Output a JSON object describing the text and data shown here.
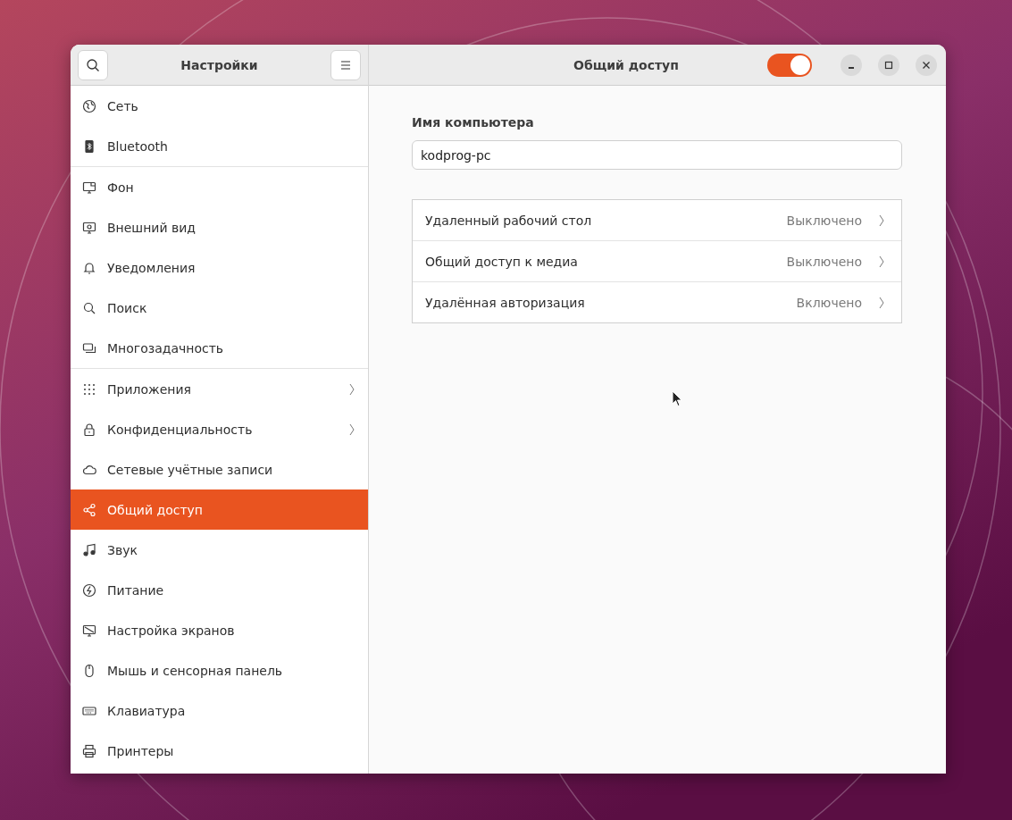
{
  "sidebar": {
    "title": "Настройки",
    "sections": [
      {
        "items": [
          {
            "label": "Сеть",
            "selected": false,
            "arrow": false
          },
          {
            "label": "Bluetooth",
            "selected": false,
            "arrow": false
          }
        ]
      },
      {
        "items": [
          {
            "label": "Фон",
            "selected": false,
            "arrow": false
          },
          {
            "label": "Внешний вид",
            "selected": false,
            "arrow": false
          },
          {
            "label": "Уведомления",
            "selected": false,
            "arrow": false
          },
          {
            "label": "Поиск",
            "selected": false,
            "arrow": false
          },
          {
            "label": "Многозадачность",
            "selected": false,
            "arrow": false
          }
        ]
      },
      {
        "items": [
          {
            "label": "Приложения",
            "selected": false,
            "arrow": true
          },
          {
            "label": "Конфиденциальность",
            "selected": false,
            "arrow": true
          },
          {
            "label": "Сетевые учётные записи",
            "selected": false,
            "arrow": false
          },
          {
            "label": "Общий доступ",
            "selected": true,
            "arrow": false
          },
          {
            "label": "Звук",
            "selected": false,
            "arrow": false
          },
          {
            "label": "Питание",
            "selected": false,
            "arrow": false
          },
          {
            "label": "Настройка экранов",
            "selected": false,
            "arrow": false
          },
          {
            "label": "Мышь и сенсорная панель",
            "selected": false,
            "arrow": false
          },
          {
            "label": "Клавиатура",
            "selected": false,
            "arrow": false
          },
          {
            "label": "Принтеры",
            "selected": false,
            "arrow": false
          }
        ]
      }
    ]
  },
  "main": {
    "title": "Общий доступ",
    "sharing_on": true,
    "computer_name": {
      "label": "Имя компьютера",
      "value": "kodprog-pc"
    },
    "rows": [
      {
        "label": "Удаленный рабочий стол",
        "status": "Выключено"
      },
      {
        "label": "Общий доступ к медиа",
        "status": "Выключено"
      },
      {
        "label": "Удалённая авторизация",
        "status": "Включено"
      }
    ]
  }
}
